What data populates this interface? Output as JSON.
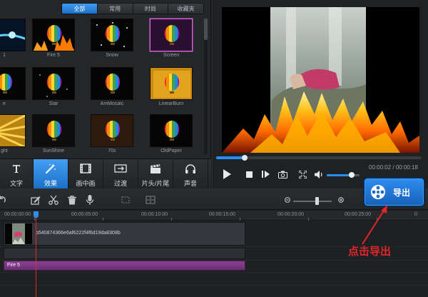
{
  "filter_tabs": [
    {
      "label": "全部",
      "active": true
    },
    {
      "label": "常用",
      "active": false
    },
    {
      "label": "时尚",
      "active": false
    },
    {
      "label": "收藏夹",
      "active": false
    }
  ],
  "effect_thumbnails": [
    {
      "label": "1",
      "style": "sparkle-blue"
    },
    {
      "label": "Fire 5",
      "style": "balloon-fire"
    },
    {
      "label": "Snow",
      "style": "balloon-snow"
    },
    {
      "label": "Screen",
      "style": "balloon-screen"
    },
    {
      "label": "e",
      "style": "balloon-dark"
    },
    {
      "label": "Star",
      "style": "balloon-star"
    },
    {
      "label": "AmMosaic",
      "style": "balloon-dark"
    },
    {
      "label": "LinearBurn",
      "style": "balloon-burn"
    },
    {
      "label": "ght",
      "style": "gold-rays"
    },
    {
      "label": "SunShine",
      "style": "balloon-light"
    },
    {
      "label": "70s",
      "style": "balloon-70s"
    },
    {
      "label": "OldPaper",
      "style": "balloon-dark"
    }
  ],
  "tool_tabs": [
    {
      "label": "文字",
      "icon": "text-icon",
      "active": false
    },
    {
      "label": "效果",
      "icon": "magic-wand-icon",
      "active": true
    },
    {
      "label": "画中画",
      "icon": "film-strip-icon",
      "active": false
    },
    {
      "label": "过渡",
      "icon": "transition-icon",
      "active": false
    },
    {
      "label": "片头/片尾",
      "icon": "clapper-icon",
      "active": false
    },
    {
      "label": "声音",
      "icon": "headphones-icon",
      "active": false
    }
  ],
  "player": {
    "time_readout": "00:00:02 / 00:00:18",
    "progress": 0.14,
    "volume": 0.75
  },
  "timeline": {
    "ruler_labels": [
      "00:00:00:00",
      "00:00:05:00",
      "00:00:10:00",
      "00:00:15:00",
      "00:00:20:00",
      "00:00:25:00",
      "0"
    ],
    "clip_name": "b540874366e6af6222f4f6d19da8308b",
    "effect_name": "Fire 5",
    "zoom": 0.62
  },
  "export": {
    "label": "导出"
  },
  "annotation": {
    "text": "点击导出"
  },
  "colors": {
    "accent": "#2a8df0",
    "annotation": "#e1262b",
    "effect_track": "#7a3682"
  }
}
